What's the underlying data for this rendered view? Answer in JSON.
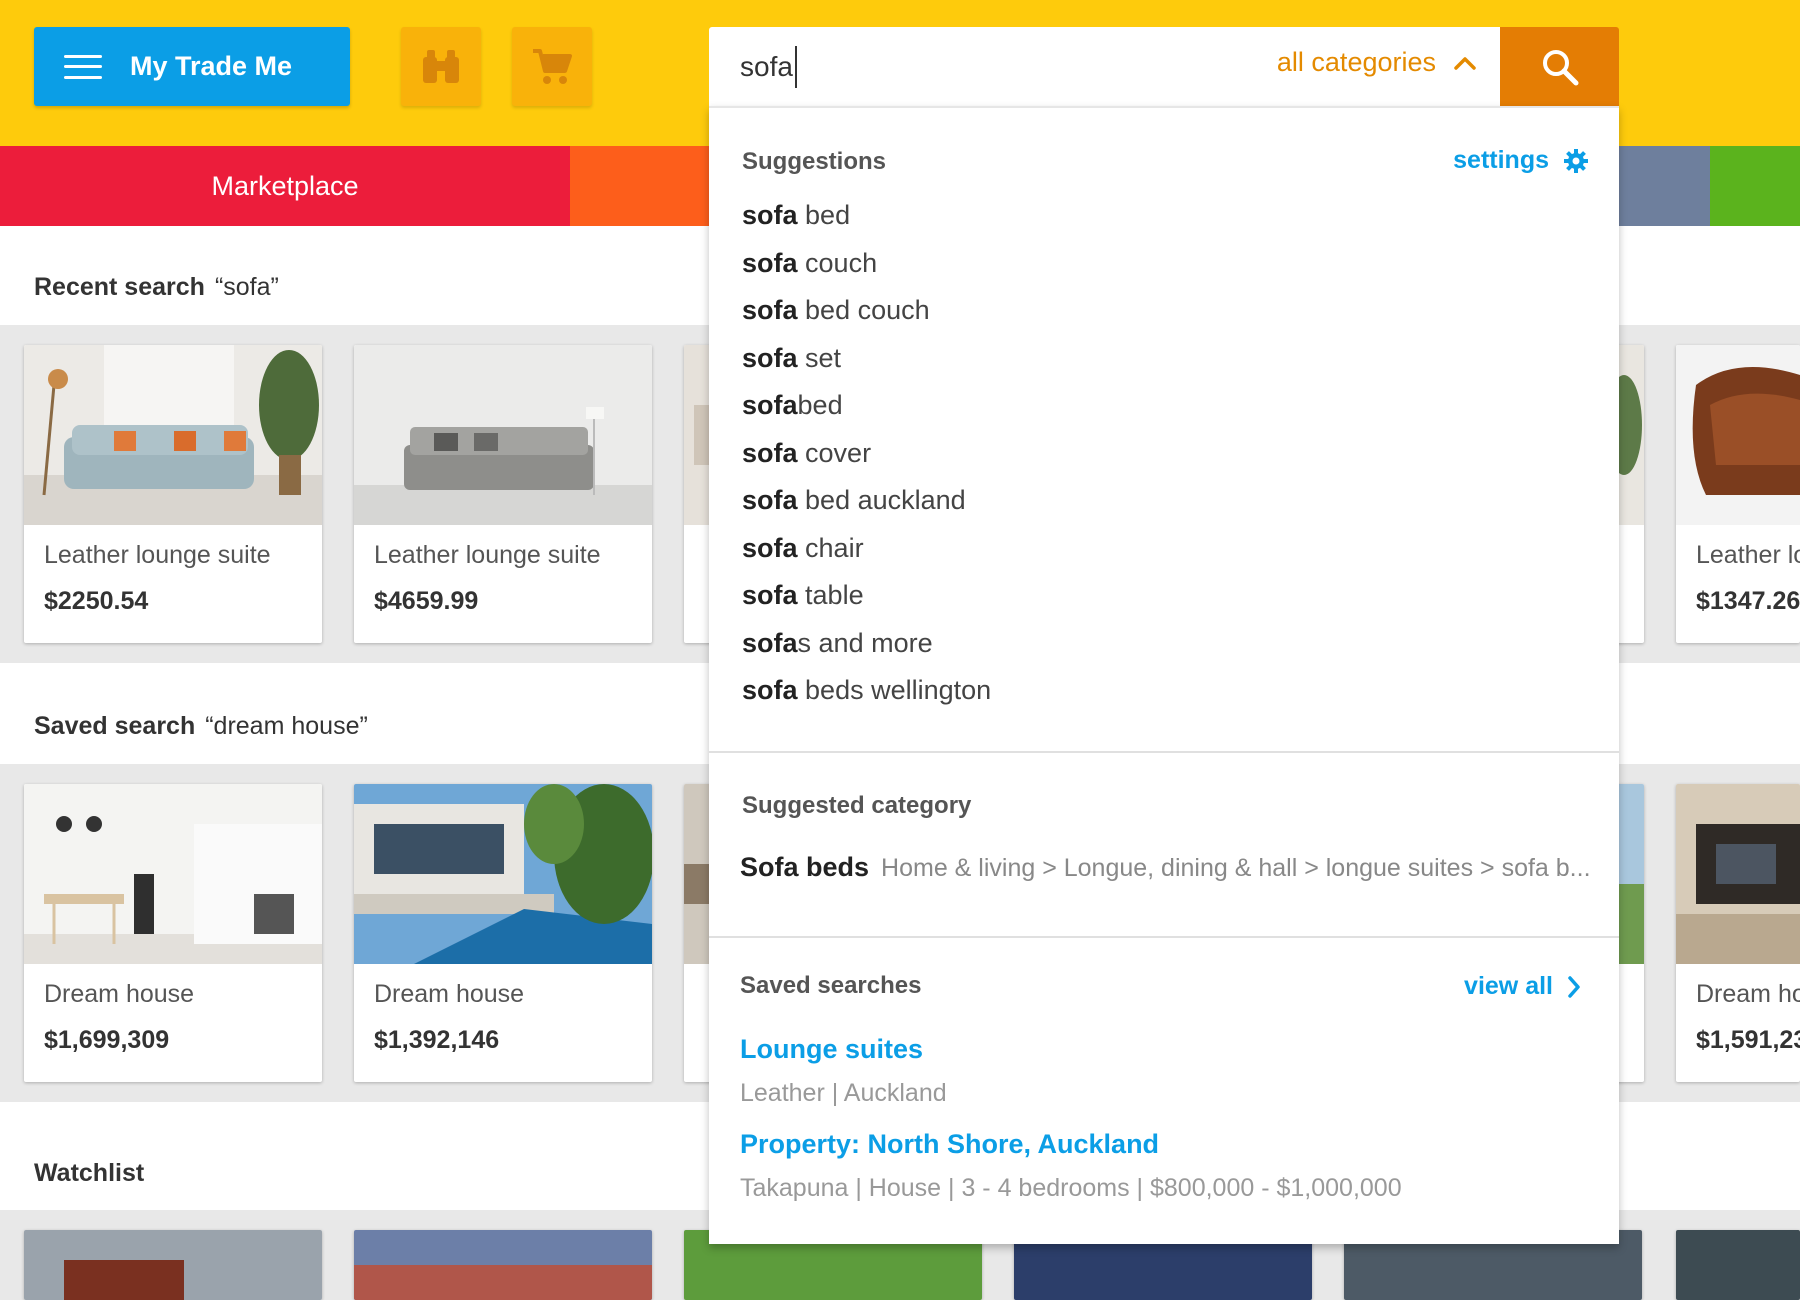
{
  "header": {
    "my_trade_me_label": "My Trade Me",
    "watchlist_icon": "binoculars-icon",
    "cart_icon": "cart-icon"
  },
  "search": {
    "value": "sofa",
    "category_label": "all categories",
    "search_icon": "search-icon"
  },
  "categories": {
    "marketplace_label": "Marketplace",
    "colors": [
      "#ec1d3b",
      "#fd5e1b",
      "#6e7f9d",
      "#5bb31d"
    ]
  },
  "sections": {
    "recent": {
      "label": "Recent search",
      "query": "“sofa”",
      "cards": [
        {
          "title": "Leather lounge suite",
          "price": "$2250.54"
        },
        {
          "title": "Leather lounge suite",
          "price": "$4659.99"
        },
        {
          "title": "Leather lo",
          "price": "$1347.26"
        }
      ]
    },
    "saved": {
      "label": "Saved search",
      "query": "“dream house”",
      "cards": [
        {
          "title": "Dream house",
          "price": "$1,699,309"
        },
        {
          "title": "Dream house",
          "price": "$1,392,146"
        },
        {
          "title": "Dream ho",
          "price": "$1,591,23"
        }
      ]
    },
    "watchlist": {
      "label": "Watchlist"
    }
  },
  "dropdown": {
    "suggestions_heading": "Suggestions",
    "settings_label": "settings",
    "suggestions": [
      {
        "prefix": "sofa",
        "rest": " bed"
      },
      {
        "prefix": "sofa",
        "rest": " couch"
      },
      {
        "prefix": "sofa",
        "rest": " bed couch"
      },
      {
        "prefix": "sofa",
        "rest": " set"
      },
      {
        "prefix": "sofa",
        "rest": "bed"
      },
      {
        "prefix": "sofa",
        "rest": " cover"
      },
      {
        "prefix": "sofa",
        "rest": " bed auckland"
      },
      {
        "prefix": "sofa",
        "rest": " chair"
      },
      {
        "prefix": "sofa",
        "rest": " table"
      },
      {
        "prefix": "sofa",
        "rest": "s and more"
      },
      {
        "prefix": "sofa",
        "rest": " beds wellington"
      }
    ],
    "suggested_category_heading": "Suggested category",
    "suggested_category": {
      "name": "Sofa beds",
      "path": "Home & living > Longue, dining & hall > longue suites > sofa b..."
    },
    "saved_searches_heading": "Saved searches",
    "view_all_label": "view all",
    "saved_searches": [
      {
        "title": "Lounge suites",
        "subtitle": "Leather | Auckland"
      },
      {
        "title": "Property: North Shore, Auckland",
        "subtitle": "Takapuna | House | 3 - 4 bedrooms | $800,000 - $1,000,000"
      }
    ]
  },
  "colors": {
    "header_yellow": "#fecb0c",
    "my_trade_me_blue": "#0b9ee6",
    "search_orange": "#e47d04",
    "link_blue": "#0b9ee6"
  }
}
